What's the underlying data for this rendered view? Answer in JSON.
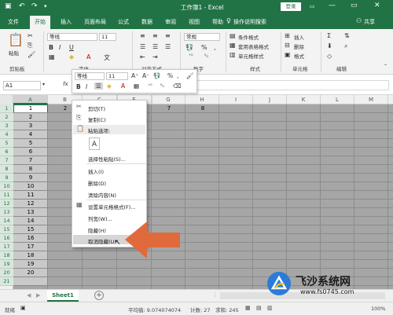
{
  "titlebar": {
    "title": "工作簿1 - Excel",
    "login": "登录",
    "minimize": "—",
    "restore": "▭",
    "close": "✕"
  },
  "tabs": [
    "文件",
    "开始",
    "插入",
    "页面布局",
    "公式",
    "数据",
    "审阅",
    "视图",
    "帮助"
  ],
  "tell_me": "操作说明搜索",
  "share": "共享",
  "ribbon": {
    "paste": "粘贴",
    "clipboard": "剪贴板",
    "font_name": "等线",
    "font_size": "11",
    "font_group": "字体",
    "align_group": "对齐方式",
    "number_format": "常规",
    "percent": "%",
    "comma": ",",
    "number_group": "数字",
    "cond_format": "条件格式",
    "table_format": "套用表格格式",
    "cell_style": "单元格样式",
    "style_group": "样式",
    "insert": "插入",
    "delete": "删除",
    "format": "格式",
    "cells_group": "单元格",
    "edit_group": "编辑"
  },
  "formula_bar": {
    "name_box": "A1",
    "fx": "fx"
  },
  "mini_toolbar": {
    "font_name": "等线",
    "font_size": "11",
    "bold": "B",
    "italic": "I",
    "percent": "%",
    "comma": ","
  },
  "grid": {
    "columns": [
      "A",
      "B",
      "C",
      "D",
      "E",
      "F",
      "G",
      "H",
      "I",
      "J",
      "K",
      "L",
      "M"
    ],
    "rows": [
      "1",
      "2",
      "3",
      "4",
      "5",
      "6",
      "7",
      "8",
      "9",
      "10",
      "11",
      "12",
      "13",
      "14",
      "15",
      "16",
      "17",
      "18",
      "19",
      "20",
      "21"
    ],
    "col_a_values": [
      "1",
      "2",
      "3",
      "4",
      "5",
      "6",
      "7",
      "8",
      "9",
      "10",
      "11",
      "12",
      "13",
      "14",
      "15",
      "16",
      "17",
      "18",
      "19",
      "20"
    ],
    "row1_b": "2",
    "row1_g": "7",
    "row1_h": "8"
  },
  "context_menu": {
    "cut": "剪切(T)",
    "copy": "复制(C)",
    "paste_options": "粘贴选项:",
    "paste_special": "选择性粘贴(S)...",
    "insert": "插入(I)",
    "delete": "删除(D)",
    "clear": "清除内容(N)",
    "format_cells": "设置单元格格式(F)...",
    "col_width": "列宽(W)...",
    "hide": "隐藏(H)",
    "unhide": "取消隐藏(U)"
  },
  "sheets": {
    "tab1": "Sheet1",
    "add": "+"
  },
  "status": {
    "mode": "就绪",
    "average": "平均值: 9.074074074",
    "count": "计数: 27",
    "sum": "求和: 245",
    "zoom": "100%"
  },
  "watermark": {
    "brand": "飞沙系统网",
    "url": "www.fs0745.com"
  },
  "colors": {
    "excel_green": "#217346",
    "arrow": "#e06a3c",
    "grid_gray": "#a6a6a6"
  }
}
